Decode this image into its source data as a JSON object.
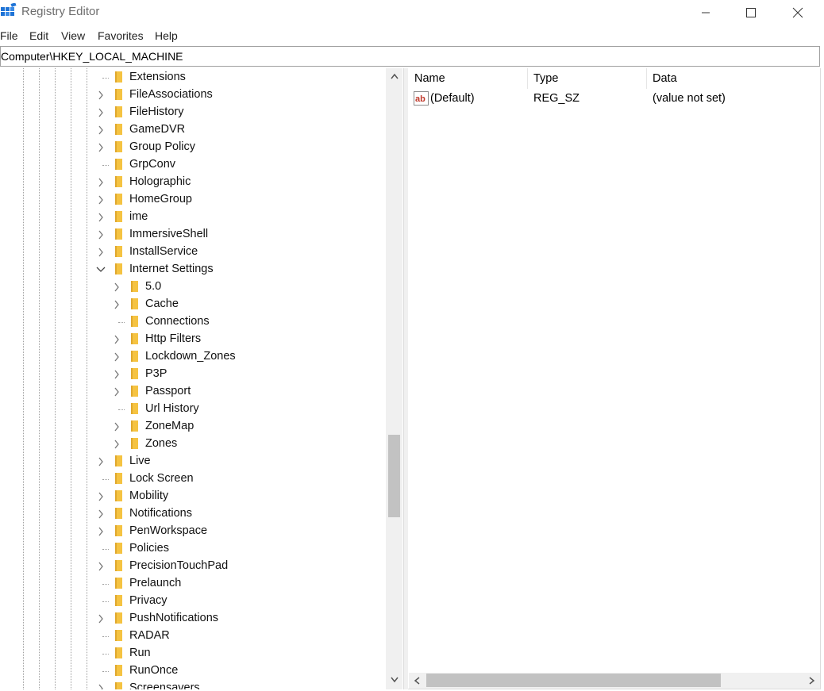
{
  "window": {
    "title": "Registry Editor",
    "controls": {
      "minimize": "minimize",
      "maximize": "maximize",
      "close": "close"
    }
  },
  "menu": [
    "File",
    "Edit",
    "View",
    "Favorites",
    "Help"
  ],
  "address": "Computer\\HKEY_LOCAL_MACHINE",
  "tree": {
    "nodes": [
      {
        "label": "Extensions",
        "level": 1,
        "state": "leaf"
      },
      {
        "label": "FileAssociations",
        "level": 1,
        "state": "collapsed"
      },
      {
        "label": "FileHistory",
        "level": 1,
        "state": "collapsed"
      },
      {
        "label": "GameDVR",
        "level": 1,
        "state": "collapsed"
      },
      {
        "label": "Group Policy",
        "level": 1,
        "state": "collapsed"
      },
      {
        "label": "GrpConv",
        "level": 1,
        "state": "leaf"
      },
      {
        "label": "Holographic",
        "level": 1,
        "state": "collapsed"
      },
      {
        "label": "HomeGroup",
        "level": 1,
        "state": "collapsed"
      },
      {
        "label": "ime",
        "level": 1,
        "state": "collapsed"
      },
      {
        "label": "ImmersiveShell",
        "level": 1,
        "state": "collapsed"
      },
      {
        "label": "InstallService",
        "level": 1,
        "state": "collapsed"
      },
      {
        "label": "Internet Settings",
        "level": 1,
        "state": "expanded"
      },
      {
        "label": "5.0",
        "level": 2,
        "state": "collapsed"
      },
      {
        "label": "Cache",
        "level": 2,
        "state": "collapsed"
      },
      {
        "label": "Connections",
        "level": 2,
        "state": "leaf"
      },
      {
        "label": "Http Filters",
        "level": 2,
        "state": "collapsed"
      },
      {
        "label": "Lockdown_Zones",
        "level": 2,
        "state": "collapsed"
      },
      {
        "label": "P3P",
        "level": 2,
        "state": "collapsed"
      },
      {
        "label": "Passport",
        "level": 2,
        "state": "collapsed"
      },
      {
        "label": "Url History",
        "level": 2,
        "state": "leaf"
      },
      {
        "label": "ZoneMap",
        "level": 2,
        "state": "collapsed"
      },
      {
        "label": "Zones",
        "level": 2,
        "state": "collapsed"
      },
      {
        "label": "Live",
        "level": 1,
        "state": "collapsed"
      },
      {
        "label": "Lock Screen",
        "level": 1,
        "state": "leaf"
      },
      {
        "label": "Mobility",
        "level": 1,
        "state": "collapsed"
      },
      {
        "label": "Notifications",
        "level": 1,
        "state": "collapsed"
      },
      {
        "label": "PenWorkspace",
        "level": 1,
        "state": "collapsed"
      },
      {
        "label": "Policies",
        "level": 1,
        "state": "leaf"
      },
      {
        "label": "PrecisionTouchPad",
        "level": 1,
        "state": "collapsed"
      },
      {
        "label": "Prelaunch",
        "level": 1,
        "state": "leaf"
      },
      {
        "label": "Privacy",
        "level": 1,
        "state": "leaf"
      },
      {
        "label": "PushNotifications",
        "level": 1,
        "state": "collapsed"
      },
      {
        "label": "RADAR",
        "level": 1,
        "state": "leaf"
      },
      {
        "label": "Run",
        "level": 1,
        "state": "leaf"
      },
      {
        "label": "RunOnce",
        "level": 1,
        "state": "leaf"
      },
      {
        "label": "Screensavers",
        "level": 1,
        "state": "collapsed"
      }
    ]
  },
  "list": {
    "columns": [
      "Name",
      "Type",
      "Data"
    ],
    "rows": [
      {
        "name": "(Default)",
        "type": "REG_SZ",
        "data": "(value not set)",
        "icon": "string-value-icon"
      }
    ]
  },
  "colors": {
    "folder": "#f5c342",
    "folder_dark": "#e0a82e",
    "app_icon": "#1e73d6"
  }
}
